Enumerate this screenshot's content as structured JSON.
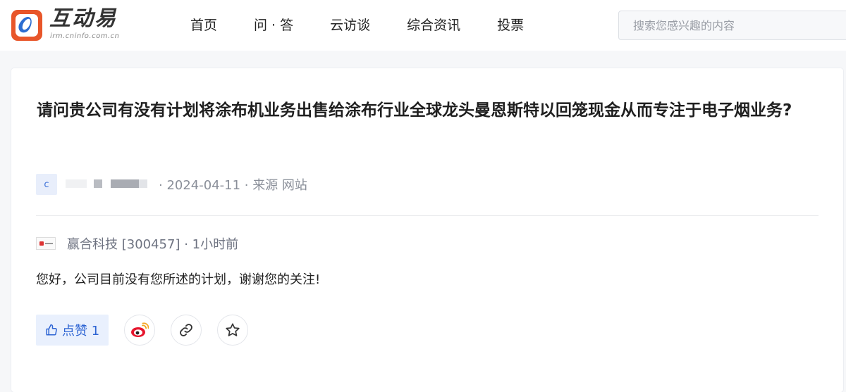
{
  "header": {
    "logo_text": "互动易",
    "logo_sub": "irm.cninfo.com.cn",
    "nav": [
      "首页",
      "问 · 答",
      "云访谈",
      "综合资讯",
      "投票"
    ],
    "search_placeholder": "搜索您感兴趣的内容"
  },
  "question": {
    "title": "请问贵公司有没有计划将涂布机业务出售给涂布行业全球龙头曼恩斯特以回笼现金从而专注于电子烟业务?",
    "avatar_letter": "c",
    "meta": "· 2024-04-11 · 来源 网站"
  },
  "answer": {
    "company_meta": "赢合科技 [300457] · 1小时前",
    "text": "您好，公司目前没有您所述的计划，谢谢您的关注!"
  },
  "actions": {
    "like_label": "点赞 1"
  },
  "colors": {
    "brand_orange": "#e8562a",
    "link_blue": "#2d64d3",
    "like_bg": "#e9f0fd"
  },
  "icons": [
    "thumbs-up-icon",
    "weibo-icon",
    "link-icon",
    "star-icon"
  ]
}
